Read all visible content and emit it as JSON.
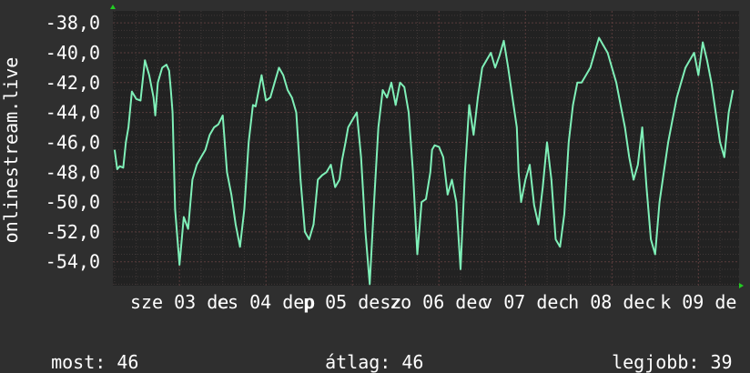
{
  "chart_data": {
    "type": "line",
    "title": "",
    "xlabel": "",
    "ylabel": "onlinestream.live",
    "ylim": [
      -55.6,
      -37.2
    ],
    "y_ticks": [
      -38,
      -40,
      -42,
      -44,
      -46,
      -48,
      -50,
      -52,
      -54
    ],
    "y_tick_labels": [
      "-38,0",
      "-40,0",
      "-42,0",
      "-44,0",
      "-46,0",
      "-48,0",
      "-50,0",
      "-52,0",
      "-54,0"
    ],
    "x_ticks": [
      {
        "label": "sze 03 de",
        "pos": 3
      },
      {
        "label": "cs 04 dep",
        "pos": 4
      },
      {
        "label": "p 05 desz",
        "pos": 5
      },
      {
        "label": "zo 06 dec",
        "pos": 6
      },
      {
        "label": "v 07 dec",
        "pos": 7
      },
      {
        "label": "h 08 dec",
        "pos": 8
      },
      {
        "label": "k 09 de",
        "pos": 9
      }
    ],
    "grid": true,
    "legend": "none",
    "colors": {
      "background": "#2f2f2f",
      "plot": "#222222",
      "line": "#7ff0b8",
      "grid_minor": "#403838",
      "grid_major": "#5a3c3c",
      "arrow": "#22cc22"
    },
    "x": [
      2.25,
      2.28,
      2.31,
      2.35,
      2.38,
      2.41,
      2.45,
      2.5,
      2.55,
      2.6,
      2.65,
      2.7,
      2.72,
      2.75,
      2.8,
      2.85,
      2.88,
      2.9,
      2.92,
      2.95,
      3.0,
      3.05,
      3.1,
      3.15,
      3.2,
      3.25,
      3.3,
      3.35,
      3.4,
      3.45,
      3.5,
      3.55,
      3.6,
      3.65,
      3.7,
      3.75,
      3.8,
      3.85,
      3.88,
      3.9,
      3.95,
      4.0,
      4.05,
      4.1,
      4.15,
      4.2,
      4.25,
      4.3,
      4.35,
      4.4,
      4.45,
      4.5,
      4.55,
      4.6,
      4.65,
      4.7,
      4.75,
      4.8,
      4.85,
      4.88,
      4.92,
      4.95,
      5.0,
      5.05,
      5.1,
      5.15,
      5.2,
      5.25,
      5.3,
      5.35,
      5.4,
      5.45,
      5.5,
      5.55,
      5.6,
      5.65,
      5.7,
      5.75,
      5.8,
      5.85,
      5.9,
      5.92,
      5.95,
      6.0,
      6.05,
      6.1,
      6.15,
      6.2,
      6.25,
      6.3,
      6.35,
      6.4,
      6.45,
      6.5,
      6.55,
      6.6,
      6.65,
      6.7,
      6.75,
      6.8,
      6.85,
      6.9,
      6.92,
      6.95,
      7.0,
      7.05,
      7.1,
      7.15,
      7.2,
      7.25,
      7.3,
      7.35,
      7.4,
      7.45,
      7.5,
      7.55,
      7.6,
      7.65,
      7.7,
      7.75,
      7.8,
      7.85,
      7.9,
      7.95,
      8.0,
      8.05,
      8.1,
      8.15,
      8.2,
      8.25,
      8.3,
      8.35,
      8.4,
      8.45,
      8.5,
      8.55,
      8.6,
      8.65,
      8.7,
      8.75,
      8.8,
      8.85,
      8.9,
      8.95,
      9.0,
      9.05,
      9.1,
      9.15,
      9.2,
      9.25,
      9.3,
      9.35,
      9.4
    ],
    "values": [
      -46.5,
      -47.8,
      -47.6,
      -47.7,
      -46.0,
      -45.0,
      -42.6,
      -43.1,
      -43.2,
      -40.5,
      -41.5,
      -43.0,
      -44.2,
      -42.0,
      -41.0,
      -40.8,
      -41.2,
      -42.5,
      -44.0,
      -50.5,
      -54.2,
      -51.0,
      -51.8,
      -48.5,
      -47.5,
      -47.0,
      -46.5,
      -45.5,
      -45.0,
      -44.8,
      -44.2,
      -48.0,
      -49.5,
      -51.5,
      -53.0,
      -50.5,
      -46.0,
      -43.5,
      -43.6,
      -43.0,
      -41.5,
      -43.2,
      -43.0,
      -42.0,
      -41.0,
      -41.5,
      -42.5,
      -43.0,
      -44.0,
      -48.5,
      -52.0,
      -52.5,
      -51.5,
      -48.5,
      -48.2,
      -48.0,
      -47.5,
      -49.0,
      -48.5,
      -47.2,
      -46.0,
      -45.0,
      -44.5,
      -44.0,
      -47.0,
      -52.0,
      -55.5,
      -50.0,
      -45.0,
      -42.5,
      -43.0,
      -42.0,
      -43.5,
      -42.0,
      -42.3,
      -44.0,
      -48.0,
      -53.5,
      -50.0,
      -49.8,
      -48.0,
      -46.5,
      -46.2,
      -46.3,
      -47.0,
      -49.5,
      -48.5,
      -50.0,
      -54.5,
      -48.0,
      -43.5,
      -45.5,
      -43.0,
      -41.0,
      -40.5,
      -40.0,
      -41.0,
      -40.2,
      -39.2,
      -41.0,
      -43.0,
      -45.0,
      -48.0,
      -50.0,
      -48.5,
      -47.5,
      -50.2,
      -51.5,
      -49.0,
      -46.0,
      -48.5,
      -52.5,
      -53.0,
      -50.8,
      -46.0,
      -43.5,
      -42.0,
      -42.0,
      -41.5,
      -41.0,
      -40.0,
      -39.0,
      -39.5,
      -40.0,
      -41.0,
      -42.0,
      -43.5,
      -45.0,
      -47.0,
      -48.5,
      -47.5,
      -45.0,
      -49.0,
      -52.5,
      -53.5,
      -50.0,
      -48.0,
      -46.0,
      -44.5,
      -43.0,
      -42.0,
      -41.0,
      -40.5,
      -40.0,
      -41.5,
      -39.3,
      -40.5,
      -42.0,
      -44.0,
      -46.0,
      -47.0,
      -44.0,
      -42.5,
      -45.0,
      -47.5,
      -48.0,
      -49.8,
      -50.3,
      -48.5,
      -47.0
    ],
    "x_domain": [
      2.23,
      9.47
    ]
  },
  "stats": {
    "current": {
      "label": "most:",
      "value": "46"
    },
    "average": {
      "label": "átlag:",
      "value": "46"
    },
    "max": {
      "label": "legjobb:",
      "value": "39"
    }
  }
}
